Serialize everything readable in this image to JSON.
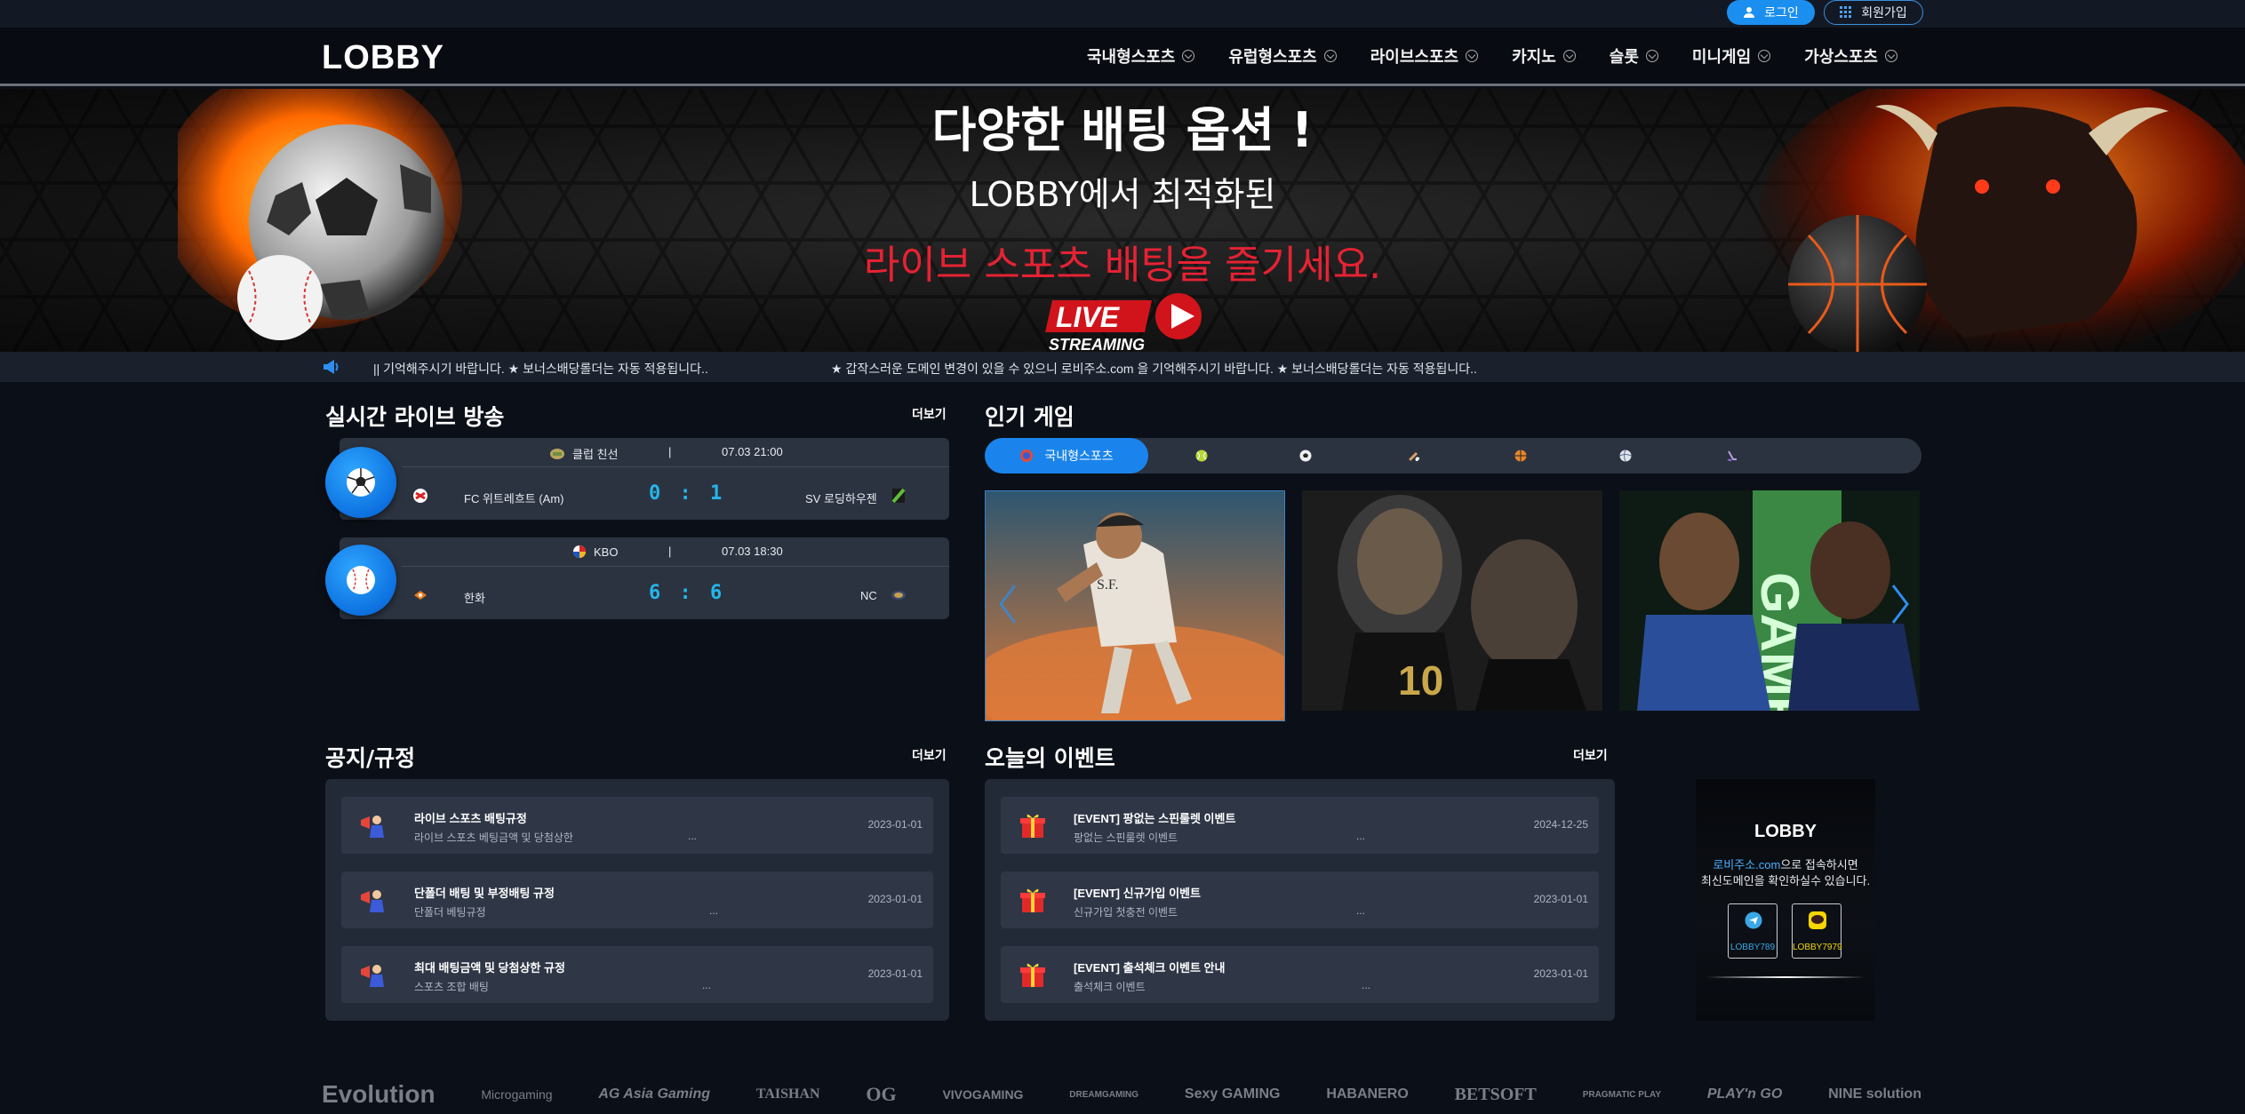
{
  "auth": {
    "login_label": "로그인",
    "signup_label": "회원가입"
  },
  "brand": {
    "logo": "LOBBY"
  },
  "nav": {
    "items": [
      "국내형스포츠",
      "유럽형스포츠",
      "라이브스포츠",
      "카지노",
      "슬롯",
      "미니게임",
      "가상스포츠"
    ]
  },
  "banner": {
    "line1": "다양한 배팅 옵션 !",
    "line2": "LOBBY에서 최적화된",
    "line3": "라이브 스포츠 배팅을 즐기세요.",
    "live_label": "LIVE",
    "streaming_label": "STREAMING"
  },
  "ticker": {
    "text1": "|| 기억해주시기 바랍니다. ★ 보너스배당롤더는 자동 적용됩니다..",
    "text2": "★ 갑작스러운 도메인 변경이 있을 수 있으니 로비주소.com 을 기억해주시기 바랍니다. ★ 보너스배당롤더는 자동 적용됩니다.."
  },
  "live": {
    "title": "실시간 라이브 방송",
    "more": "더보기",
    "matches": [
      {
        "league": "클럽 친선",
        "sep": "|",
        "time": "07.03 21:00",
        "home": "FC 위트레흐트 (Am)",
        "score": "0 : 1",
        "away": "SV 로딩하우젠"
      },
      {
        "league": "KBO",
        "sep": "|",
        "time": "07.03 18:30",
        "home": "한화",
        "score": "6 : 6",
        "away": "NC"
      }
    ]
  },
  "popular": {
    "title": "인기 게임",
    "active_tab": "국내형스포츠"
  },
  "notice": {
    "title": "공지/규정",
    "more": "더보기",
    "rows": [
      {
        "title": "라이브 스포츠 배팅규정",
        "sub": "라이브 스포츠 베팅금액 및 당첨상한",
        "dots": "...",
        "date": "2023-01-01"
      },
      {
        "title": "단폴더 배팅 및 부정배팅 규정",
        "sub": "단폴더 베팅규정",
        "dots": "...",
        "date": "2023-01-01"
      },
      {
        "title": "최대 배팅금액 및 당첨상한 규정",
        "sub": "스포츠 조합 배팅",
        "dots": "...",
        "date": "2023-01-01"
      }
    ]
  },
  "events": {
    "title": "오늘의 이벤트",
    "more": "더보기",
    "rows": [
      {
        "title": "[EVENT] 팡없는 스핀룰렛 이벤트",
        "sub": "팡없는 스핀룰렛 이벤트",
        "dots": "...",
        "date": "2024-12-25"
      },
      {
        "title": "[EVENT] 신규가입 이벤트",
        "sub": "신규가입 첫충전 이벤트",
        "dots": "...",
        "date": "2023-01-01"
      },
      {
        "title": "[EVENT] 출석체크 이벤트 안내",
        "sub": "출석체크 이벤트",
        "dots": "...",
        "date": "2023-01-01"
      }
    ]
  },
  "promo": {
    "logo": "LOBBY",
    "line1_highlight": "로비주소.com",
    "line1_rest": "으로 접속하시면",
    "line2": "최신도메인을 확인하실수 있습니다.",
    "telegram_id": "LOBBY789",
    "kakao_id": "LOBBY7979"
  },
  "providers": [
    "Evolution",
    "Microgaming",
    "AG Asia Gaming",
    "TAISHAN",
    "OG",
    "VIVOGAMING",
    "DREAMGAMING",
    "Sexy GAMING",
    "HABANERO",
    "BETSOFT",
    "PRAGMATIC PLAY",
    "PLAY'n GO",
    "NINE solution"
  ],
  "colors": {
    "accent": "#1a84ec",
    "score": "#26b5e8",
    "banner_red": "#e62233",
    "bg": "#0b0f17",
    "panel": "#232a37"
  }
}
